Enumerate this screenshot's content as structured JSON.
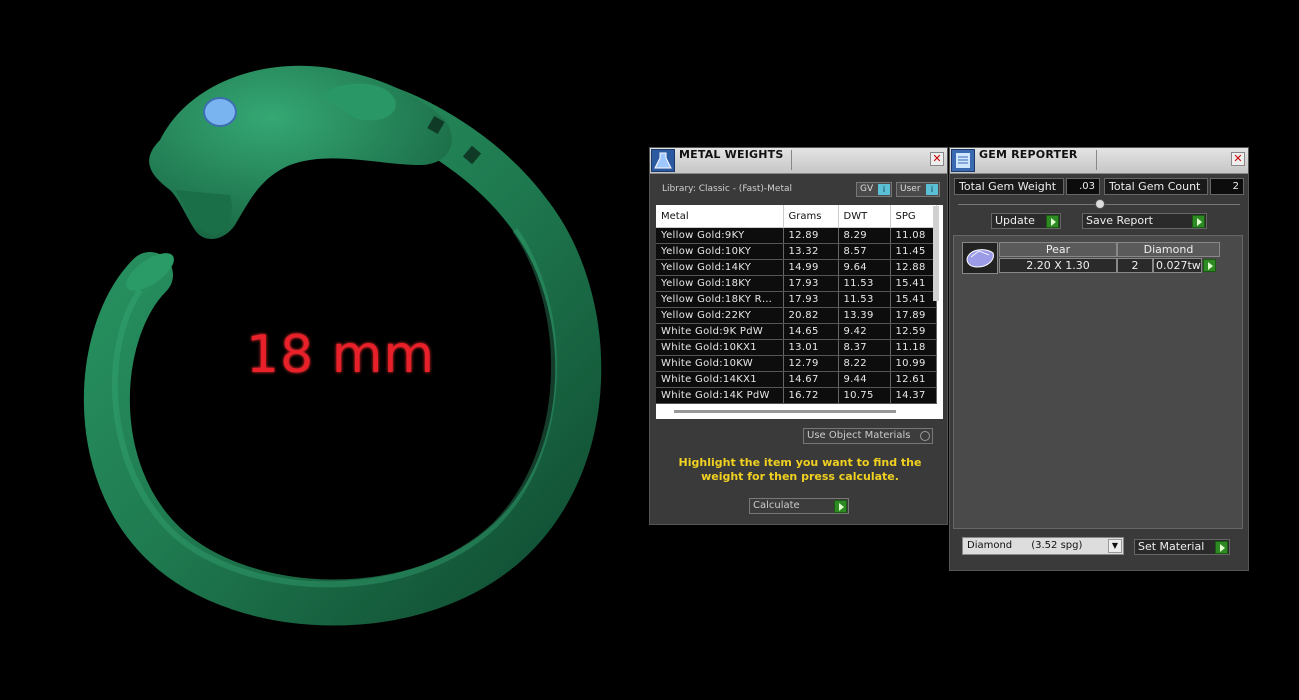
{
  "viewport": {
    "size_label": "18 mm"
  },
  "metal_weights": {
    "title": "METAL WEIGHTS",
    "library_label": "Library: Classic - (Fast)-Metal",
    "gv_label": "GV",
    "user_label": "User",
    "columns": [
      "Metal",
      "Grams",
      "DWT",
      "SPG"
    ],
    "rows": [
      [
        "Yellow Gold:9KY",
        "12.89",
        "8.29",
        "11.08"
      ],
      [
        "Yellow Gold:10KY",
        "13.32",
        "8.57",
        "11.45"
      ],
      [
        "Yellow Gold:14KY",
        "14.99",
        "9.64",
        "12.88"
      ],
      [
        "Yellow Gold:18KY",
        "17.93",
        "11.53",
        "15.41"
      ],
      [
        "Yellow Gold:18KY R…",
        "17.93",
        "11.53",
        "15.41"
      ],
      [
        "Yellow Gold:22KY",
        "20.82",
        "13.39",
        "17.89"
      ],
      [
        "White Gold:9K PdW",
        "14.65",
        "9.42",
        "12.59"
      ],
      [
        "White Gold:10KX1",
        "13.01",
        "8.37",
        "11.18"
      ],
      [
        "White Gold:10KW",
        "12.79",
        "8.22",
        "10.99"
      ],
      [
        "White Gold:14KX1",
        "14.67",
        "9.44",
        "12.61"
      ],
      [
        "White Gold:14K PdW",
        "16.72",
        "10.75",
        "14.37"
      ]
    ],
    "use_object_materials": "Use Object Materials",
    "hint": "Highlight the item you want to find the weight for then press calculate.",
    "calculate_label": "Calculate"
  },
  "gem_reporter": {
    "title": "GEM REPORTER",
    "total_weight_label": "Total Gem Weight",
    "total_weight_value": ".03",
    "total_count_label": "Total Gem Count",
    "total_count_value": "2",
    "update_label": "Update",
    "save_report_label": "Save Report",
    "gem": {
      "shape": "Pear",
      "material": "Diamond",
      "size": "2.20 X 1.30",
      "count": "2",
      "weight": "0.027tw"
    },
    "material_select": "Diamond      (3.52 spg)",
    "set_material_label": "Set Material"
  },
  "colors": {
    "ring": "#1f7a50",
    "gem_eye": "#7ab4f0",
    "hint_text": "#f0d020",
    "size_label": "#e8202a"
  }
}
